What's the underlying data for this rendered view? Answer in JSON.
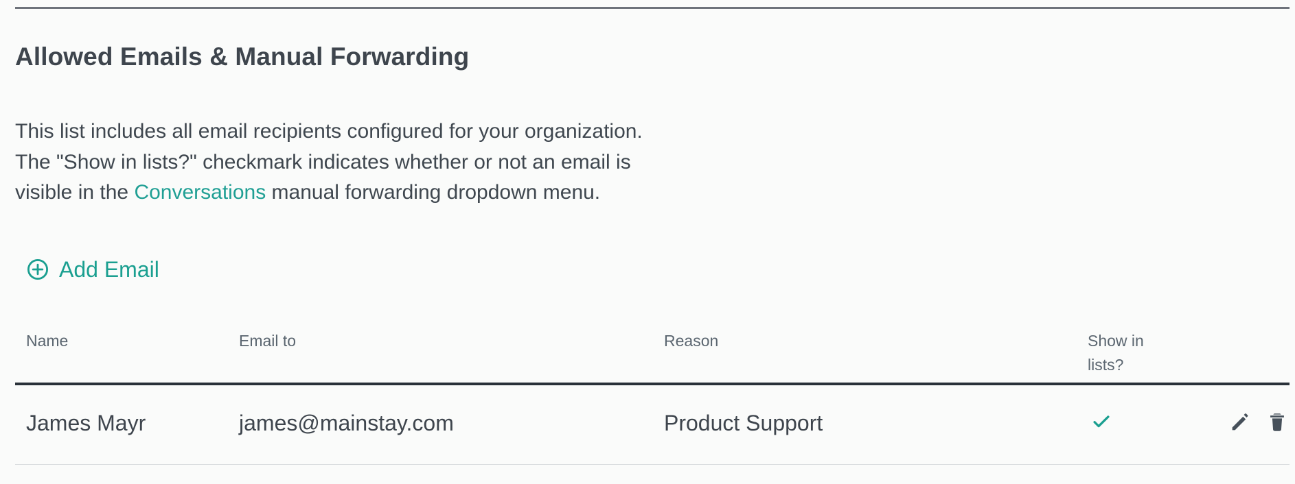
{
  "section": {
    "title": "Allowed Emails & Manual Forwarding",
    "description": {
      "before_link": "This list includes all email recipients configured for your organization. The \"Show in lists?\" checkmark indicates whether or not an email is visible in the ",
      "link": "Conversations",
      "after_link": " manual forwarding dropdown menu."
    },
    "add_button_label": "Add Email"
  },
  "table": {
    "columns": {
      "name": "Name",
      "email": "Email to",
      "reason": "Reason",
      "show": "Show in lists?"
    },
    "rows": [
      {
        "name": "James Mayr",
        "email": "james@mainstay.com",
        "reason": "Product Support",
        "show_in_lists": true
      }
    ]
  },
  "icons": {
    "add": "plus-circle-icon",
    "check": "check-icon",
    "edit": "pencil-icon",
    "delete": "trash-icon"
  },
  "colors": {
    "accent": "#1a9f90",
    "text": "#3e454d",
    "muted": "#5b6670",
    "rule": "#6e737b",
    "header_divider": "#293139",
    "row_divider": "#d9dcde"
  }
}
